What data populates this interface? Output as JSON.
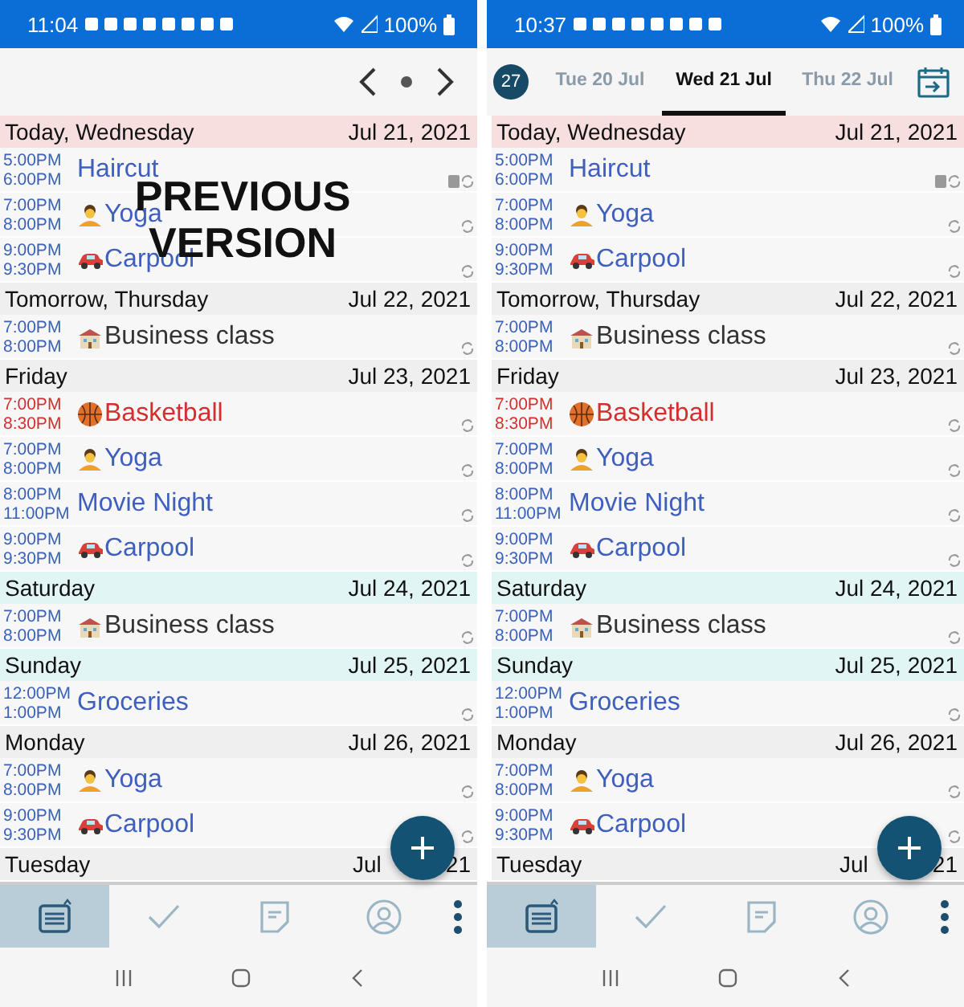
{
  "panels": [
    {
      "status_bar": {
        "time": "11:04",
        "battery": "100%"
      },
      "header": {
        "kind": "arrows"
      },
      "overlay": [
        "PREVIOUS",
        "VERSION"
      ],
      "days": [
        {
          "label": "Today, Wednesday",
          "date": "Jul 21, 2021",
          "kind": "today",
          "entries": [
            {
              "start": "5:00PM",
              "end": "6:00PM",
              "title": "Haircut",
              "kind": "plain",
              "color": "#3f5fbf",
              "attachment": true
            },
            {
              "start": "7:00PM",
              "end": "8:00PM",
              "title": "Yoga",
              "kind": "person",
              "color": "#3f5fbf",
              "attachment": false
            },
            {
              "start": "9:00PM",
              "end": "9:30PM",
              "title": "Carpool",
              "kind": "car",
              "color": "#3f5fbf",
              "attachment": false
            }
          ]
        },
        {
          "label": "Tomorrow, Thursday",
          "date": "Jul 22, 2021",
          "kind": "weekday",
          "entries": [
            {
              "start": "7:00PM",
              "end": "8:00PM",
              "title": "Business class",
              "kind": "school",
              "color": "#333333",
              "attachment": false
            }
          ]
        },
        {
          "label": "Friday",
          "date": "Jul 23, 2021",
          "kind": "weekday",
          "entries": [
            {
              "start": "7:00PM",
              "end": "8:30PM",
              "title": "Basketball",
              "kind": "ball",
              "color": "#d32f2f",
              "attachment": false
            },
            {
              "start": "7:00PM",
              "end": "8:00PM",
              "title": "Yoga",
              "kind": "person",
              "color": "#3f5fbf",
              "attachment": false
            },
            {
              "start": "8:00PM",
              "end": "11:00PM",
              "title": "Movie Night",
              "kind": "plain",
              "color": "#3f5fbf",
              "attachment": false
            },
            {
              "start": "9:00PM",
              "end": "9:30PM",
              "title": "Carpool",
              "kind": "car",
              "color": "#3f5fbf",
              "attachment": false
            }
          ]
        },
        {
          "label": "Saturday",
          "date": "Jul 24, 2021",
          "kind": "weekend",
          "entries": [
            {
              "start": "7:00PM",
              "end": "8:00PM",
              "title": "Business class",
              "kind": "school",
              "color": "#333333",
              "attachment": false
            }
          ]
        },
        {
          "label": "Sunday",
          "date": "Jul 25, 2021",
          "kind": "weekend",
          "entries": [
            {
              "start": "12:00PM",
              "end": "1:00PM",
              "title": "Groceries",
              "kind": "plain",
              "color": "#3f5fbf",
              "attachment": false
            }
          ]
        },
        {
          "label": "Monday",
          "date": "Jul 26, 2021",
          "kind": "weekday",
          "entries": [
            {
              "start": "7:00PM",
              "end": "8:00PM",
              "title": "Yoga",
              "kind": "person",
              "color": "#3f5fbf",
              "attachment": false
            },
            {
              "start": "9:00PM",
              "end": "9:30PM",
              "title": "Carpool",
              "kind": "car",
              "color": "#3f5fbf",
              "attachment": false
            }
          ]
        },
        {
          "label": "Tuesday",
          "date": "Jul",
          "date_end": "21",
          "kind": "weekday"
        }
      ],
      "bottom_nav": [
        {
          "kind": "agenda",
          "selected": true
        },
        {
          "kind": "tasks",
          "selected": false
        },
        {
          "kind": "notes",
          "selected": false
        },
        {
          "kind": "contacts",
          "selected": false
        },
        {
          "kind": "more",
          "selected": false
        }
      ]
    },
    {
      "status_bar": {
        "time": "10:37",
        "battery": "100%"
      },
      "header": {
        "kind": "tabs",
        "badge": "27",
        "tabs": [
          {
            "label": "Tue 20 Jul",
            "selected": false
          },
          {
            "label": "Wed 21 Jul",
            "selected": true
          },
          {
            "label": "Thu 22 Jul",
            "selected": false
          }
        ]
      },
      "days": [
        {
          "label": "Today, Wednesday",
          "date": "Jul 21, 2021",
          "kind": "today",
          "entries": [
            {
              "start": "5:00PM",
              "end": "6:00PM",
              "title": "Haircut",
              "kind": "plain",
              "color": "#3f5fbf",
              "attachment": true
            },
            {
              "start": "7:00PM",
              "end": "8:00PM",
              "title": "Yoga",
              "kind": "person",
              "color": "#3f5fbf",
              "attachment": false
            },
            {
              "start": "9:00PM",
              "end": "9:30PM",
              "title": "Carpool",
              "kind": "car",
              "color": "#3f5fbf",
              "attachment": false
            }
          ]
        },
        {
          "label": "Tomorrow, Thursday",
          "date": "Jul 22, 2021",
          "kind": "weekday",
          "entries": [
            {
              "start": "7:00PM",
              "end": "8:00PM",
              "title": "Business class",
              "kind": "school",
              "color": "#333333",
              "attachment": false
            }
          ]
        },
        {
          "label": "Friday",
          "date": "Jul 23, 2021",
          "kind": "weekday",
          "entries": [
            {
              "start": "7:00PM",
              "end": "8:30PM",
              "title": "Basketball",
              "kind": "ball",
              "color": "#d32f2f",
              "attachment": false
            },
            {
              "start": "7:00PM",
              "end": "8:00PM",
              "title": "Yoga",
              "kind": "person",
              "color": "#3f5fbf",
              "attachment": false
            },
            {
              "start": "8:00PM",
              "end": "11:00PM",
              "title": "Movie Night",
              "kind": "plain",
              "color": "#3f5fbf",
              "attachment": false
            },
            {
              "start": "9:00PM",
              "end": "9:30PM",
              "title": "Carpool",
              "kind": "car",
              "color": "#3f5fbf",
              "attachment": false
            }
          ]
        },
        {
          "label": "Saturday",
          "date": "Jul 24, 2021",
          "kind": "weekend",
          "entries": [
            {
              "start": "7:00PM",
              "end": "8:00PM",
              "title": "Business class",
              "kind": "school",
              "color": "#333333",
              "attachment": false
            }
          ]
        },
        {
          "label": "Sunday",
          "date": "Jul 25, 2021",
          "kind": "weekend",
          "entries": [
            {
              "start": "12:00PM",
              "end": "1:00PM",
              "title": "Groceries",
              "kind": "plain",
              "color": "#3f5fbf",
              "attachment": false
            }
          ]
        },
        {
          "label": "Monday",
          "date": "Jul 26, 2021",
          "kind": "weekday",
          "entries": [
            {
              "start": "7:00PM",
              "end": "8:00PM",
              "title": "Yoga",
              "kind": "person",
              "color": "#3f5fbf",
              "attachment": false
            },
            {
              "start": "9:00PM",
              "end": "9:30PM",
              "title": "Carpool",
              "kind": "car",
              "color": "#3f5fbf",
              "attachment": false
            }
          ]
        },
        {
          "label": "Tuesday",
          "date": "Jul",
          "date_end": "21",
          "kind": "weekday"
        }
      ],
      "bottom_nav": [
        {
          "kind": "agenda",
          "selected": true
        },
        {
          "kind": "tasks",
          "selected": false
        },
        {
          "kind": "notes",
          "selected": false
        },
        {
          "kind": "contacts",
          "selected": false
        },
        {
          "kind": "more",
          "selected": false
        }
      ]
    }
  ]
}
